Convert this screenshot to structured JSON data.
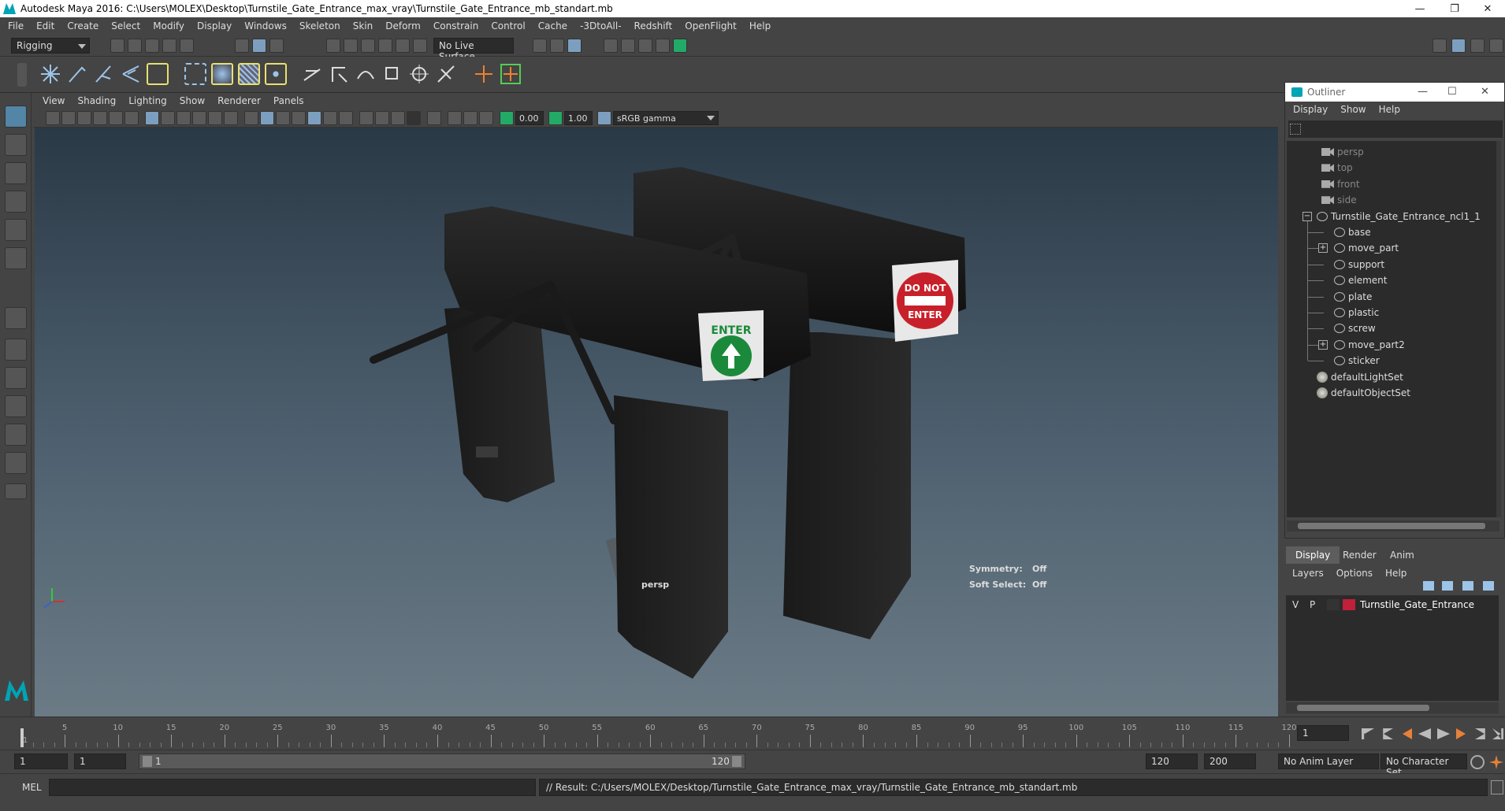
{
  "window": {
    "title": "Autodesk Maya 2016: C:\\Users\\MOLEX\\Desktop\\Turnstile_Gate_Entrance_max_vray\\Turnstile_Gate_Entrance_mb_standart.mb"
  },
  "menubar": [
    "File",
    "Edit",
    "Create",
    "Select",
    "Modify",
    "Display",
    "Windows",
    "Skeleton",
    "Skin",
    "Deform",
    "Constrain",
    "Control",
    "Cache",
    "-3DtoAll-",
    "Redshift",
    "OpenFlight",
    "Help"
  ],
  "statusline": {
    "mode": "Rigging",
    "live_surface": "No Live Surface"
  },
  "viewport_menu": [
    "View",
    "Shading",
    "Lighting",
    "Show",
    "Renderer",
    "Panels"
  ],
  "viewport_toolbar": {
    "exposure": "0.00",
    "gamma": "1.00",
    "colorspace": "sRGB gamma"
  },
  "viewport": {
    "camera_label": "persp",
    "symmetry_label": "Symmetry:",
    "symmetry_value": "Off",
    "soft_select_label": "Soft Select:",
    "soft_select_value": "Off",
    "sign_enter": "ENTER",
    "sign_do_not_1": "DO NOT",
    "sign_do_not_2": "ENTER"
  },
  "outliner": {
    "title": "Outliner",
    "menu": [
      "Display",
      "Show",
      "Help"
    ],
    "cameras": [
      "persp",
      "top",
      "front",
      "side"
    ],
    "group": "Turnstile_Gate_Entrance_ncl1_1",
    "children": [
      "base",
      "move_part",
      "support",
      "element",
      "plate",
      "plastic",
      "screw",
      "move_part2",
      "sticker"
    ],
    "sets": [
      "defaultLightSet",
      "defaultObjectSet"
    ]
  },
  "layer_editor": {
    "tabs": [
      "Display",
      "Render",
      "Anim"
    ],
    "menu": [
      "Layers",
      "Options",
      "Help"
    ],
    "layer": {
      "v": "V",
      "p": "P",
      "name": "Turnstile_Gate_Entrance",
      "color": "#c0203a"
    }
  },
  "timeline": {
    "labels": [
      "5",
      "10",
      "15",
      "20",
      "25",
      "30",
      "35",
      "40",
      "45",
      "50",
      "55",
      "60",
      "65",
      "70",
      "75",
      "80",
      "85",
      "90",
      "95",
      "100",
      "105",
      "110",
      "115",
      "120"
    ],
    "current_frame": "1",
    "first_tick_label": "1"
  },
  "range": {
    "start": "1",
    "playback_start": "1",
    "slider_start": "1",
    "slider_end": "120",
    "playback_end": "120",
    "end": "200",
    "anim_layer": "No Anim Layer",
    "character_set": "No Character Set"
  },
  "command": {
    "lang": "MEL",
    "result": "// Result: C:/Users/MOLEX/Desktop/Turnstile_Gate_Entrance_max_vray/Turnstile_Gate_Entrance_mb_standart.mb"
  },
  "colors": {
    "accent": "#5285a6",
    "brand": "#00a4b4"
  }
}
